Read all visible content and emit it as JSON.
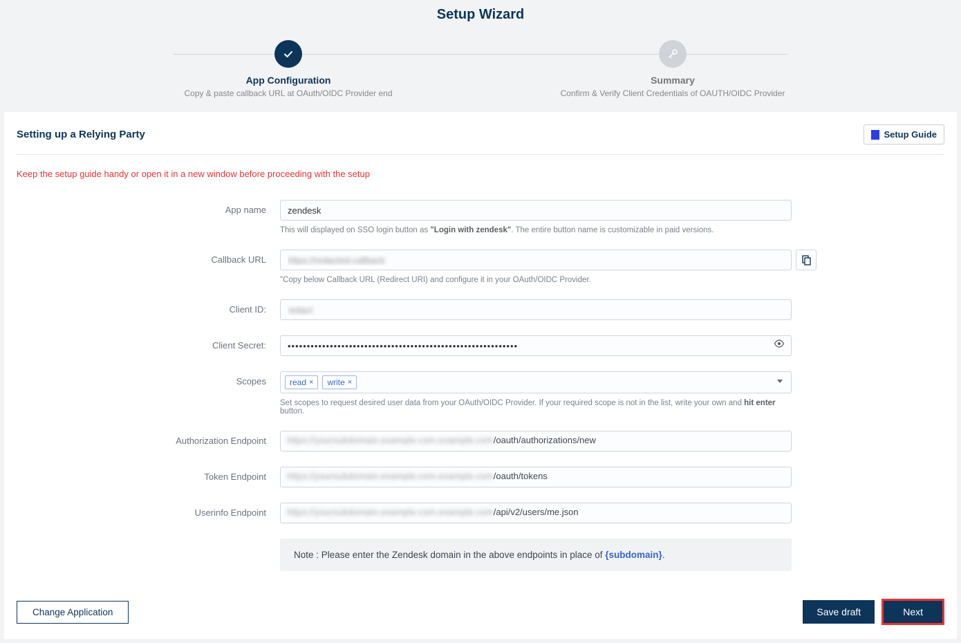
{
  "wizard": {
    "title": "Setup Wizard",
    "steps": [
      {
        "title": "App Configuration",
        "subtitle": "Copy & paste callback URL at OAuth/OIDC Provider end",
        "icon": "check"
      },
      {
        "title": "Summary",
        "subtitle": "Confirm & Verify Client Credentials of OAUTH/OIDC Provider",
        "icon": "key"
      }
    ]
  },
  "panel": {
    "heading": "Setting up a Relying Party",
    "setup_guide_label": "Setup Guide",
    "warning": "Keep the setup guide handy or open it in a new window before proceeding with the setup"
  },
  "form": {
    "app_name": {
      "label": "App name",
      "value": "zendesk",
      "help_pre": "This will displayed on SSO login button as ",
      "help_bold": "\"Login with zendesk\"",
      "help_post": ". The entire button name is customizable in paid versions."
    },
    "callback": {
      "label": "Callback URL",
      "value": "https://redacted-callback",
      "help": "\"Copy below Callback URL (Redirect URI) and configure it in your OAuth/OIDC Provider."
    },
    "client_id": {
      "label": "Client ID:",
      "value": "redact"
    },
    "client_secret": {
      "label": "Client Secret:",
      "value": "••••••••••••••••••••••••••••••••••••••••••••••••••••••••••••"
    },
    "scopes": {
      "label": "Scopes",
      "tags": [
        "read",
        "write"
      ],
      "help_pre": "Set scopes to request desired user data from your OAuth/OIDC Provider. If your required scope is not in the list, write your own and ",
      "help_bold": "hit enter",
      "help_post": " button."
    },
    "auth_ep": {
      "label": "Authorization Endpoint",
      "blur_prefix": "https://yoursubdomain.example.com.example.com",
      "visible_suffix": "/oauth/authorizations/new"
    },
    "token_ep": {
      "label": "Token Endpoint",
      "blur_prefix": "https://yoursubdomain.example.com.example.com",
      "visible_suffix": "/oauth/tokens"
    },
    "userinfo_ep": {
      "label": "Userinfo Endpoint",
      "blur_prefix": "https://yoursubdomain.example.com.example.com",
      "visible_suffix": "/api/v2/users/me.json"
    },
    "note": {
      "pre": "Note : Please enter the Zendesk domain in the above endpoints in place of ",
      "token": "{subdomain}",
      "post": "."
    }
  },
  "footer": {
    "change_app": "Change Application",
    "save_draft": "Save draft",
    "next": "Next"
  }
}
